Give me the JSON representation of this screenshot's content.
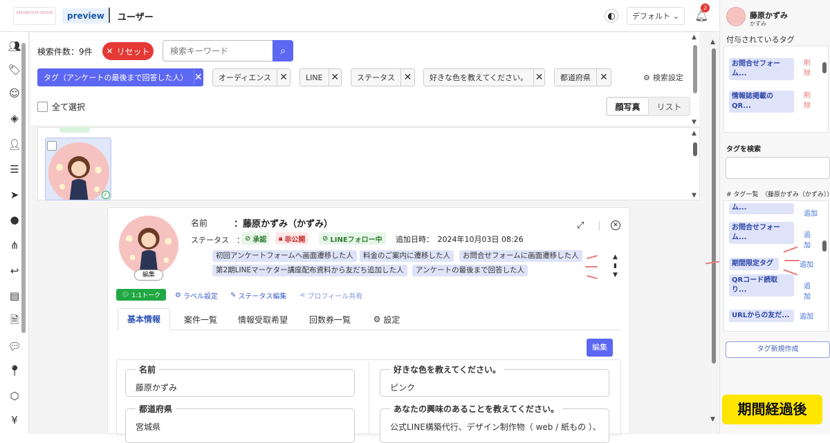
{
  "header": {
    "logo_text": "SAKURA SITE DESIGN",
    "preview_label": "preview",
    "page_title": "ユーザー",
    "theme_select": "デフォルト",
    "notification_count": "2"
  },
  "filter": {
    "count_label": "検索件数：",
    "count_value": "9件",
    "reset_label": "リセット",
    "search_placeholder": "検索キーワード",
    "chips": [
      {
        "label": "タグ（アンケートの最後まで回答した人）"
      },
      {
        "label": "オーディエンス"
      },
      {
        "label": "LINE"
      },
      {
        "label": "ステータス"
      },
      {
        "label": "好きな色を教えてください。"
      },
      {
        "label": "都道府県"
      }
    ],
    "search_settings": "検索設定",
    "select_all": "全て選択",
    "view_photo": "顔写真",
    "view_list": "リスト"
  },
  "detail": {
    "name_label": "名前",
    "name_value": "：藤原かずみ（かずみ）",
    "status_label": "ステータス　：",
    "badges": [
      "承認",
      "非公開",
      "LINEフォロー中"
    ],
    "added_label": "追加日時：　2024年10月03日 08:26",
    "avatar_edit": "編集",
    "tags": [
      "初回アンケートフォームへ画面遷移した人",
      "料金のご案内に遷移した人",
      "お問合せフォームに画面遷移した人",
      "第2期LINEマーケター講座配布資料から友だち追加した人",
      "アンケートの最後まで回答した人"
    ],
    "actions": {
      "talk": "1:1トーク",
      "label_setting": "ラベル設定",
      "status_edit": "ステータス編集",
      "profile_share": "プロフィール共有"
    },
    "tabs": [
      "基本情報",
      "案件一覧",
      "情報受取希望",
      "回数券一覧",
      "設定"
    ],
    "edit_button": "編集",
    "fields": [
      {
        "label": "名前",
        "value": "藤原かずみ"
      },
      {
        "label": "好きな色を教えてください。",
        "value": "ピンク"
      },
      {
        "label": "都道府県",
        "value": "宮城県"
      },
      {
        "label": "あなたの興味のあることを教えてください。",
        "value": "公式LINE構築代行、デザイン制作物（ web / 紙もの ）、"
      }
    ]
  },
  "right": {
    "user_name": "藤原かずみ",
    "user_sub": "かずみ",
    "assigned_title": "付与されているタグ",
    "assigned": [
      {
        "label": "お問合せフォーム...",
        "action": "削除"
      },
      {
        "label": "情報誌掲載のQR...",
        "action": "削除"
      }
    ],
    "search_title": "タグを検索",
    "list_title": "# タグ一覧　（藤原かずみ（かずみ））",
    "list": [
      {
        "label": "ム...",
        "action": "追加"
      },
      {
        "label": "お問合せフォーム...",
        "action": "追加"
      },
      {
        "label": "期間限定タグ",
        "action": "追加"
      },
      {
        "label": "QRコード読取り...",
        "action": "追加"
      },
      {
        "label": "URLからの友だ...",
        "action": "追加"
      }
    ],
    "new_tag": "タグ新規作成",
    "elapsed": "期間経過後"
  },
  "colors": {
    "accent": "#5c67f2",
    "reset": "#e53935",
    "line_green": "#21a744",
    "highlight": "#ffe600"
  }
}
